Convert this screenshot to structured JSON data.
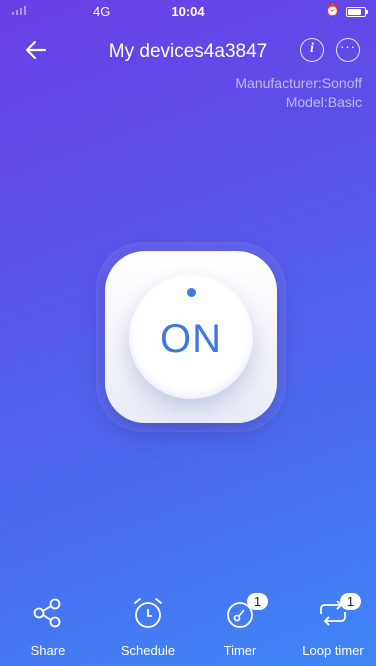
{
  "status_bar": {
    "network": "4G",
    "time": "10:04"
  },
  "header": {
    "title": "My devices4a3847"
  },
  "device": {
    "manufacturer": "Manufacturer:Sonoff",
    "model": "Model:Basic"
  },
  "switch": {
    "state": "ON"
  },
  "bottom_bar": {
    "items": [
      {
        "label": "Share",
        "icon": "share-icon"
      },
      {
        "label": "Schedule",
        "icon": "alarm-clock-icon"
      },
      {
        "label": "Timer",
        "icon": "timer-icon",
        "badge": "1"
      },
      {
        "label": "Loop timer",
        "icon": "loop-icon",
        "badge": "1"
      }
    ]
  },
  "colors": {
    "accent": "#3d78e0",
    "gradient_start": "#6a3fe6",
    "gradient_end": "#3f86f6"
  }
}
